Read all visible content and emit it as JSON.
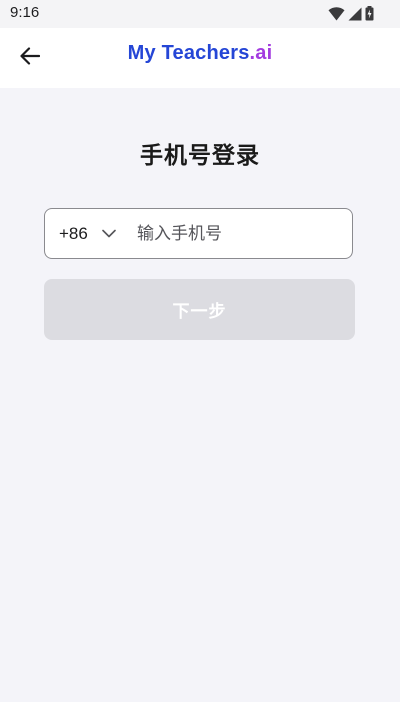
{
  "status_bar": {
    "time": "9:16",
    "icons": [
      "wifi-icon",
      "cellular-signal-icon",
      "battery-charging-icon"
    ]
  },
  "header": {
    "back_icon": "arrow-left-icon",
    "brand_main": "My Teachers",
    "brand_tld": ".ai",
    "brand_colors": {
      "main": "#2546d6",
      "tld": "#a33be0"
    }
  },
  "main": {
    "title": "手机号登录",
    "phone_field": {
      "country_code": "+86",
      "country_code_icon": "chevron-down-icon",
      "value": "",
      "placeholder": "输入手机号"
    },
    "next_button": {
      "label": "下一步",
      "state": "disabled",
      "background": "#dcdce1"
    }
  }
}
